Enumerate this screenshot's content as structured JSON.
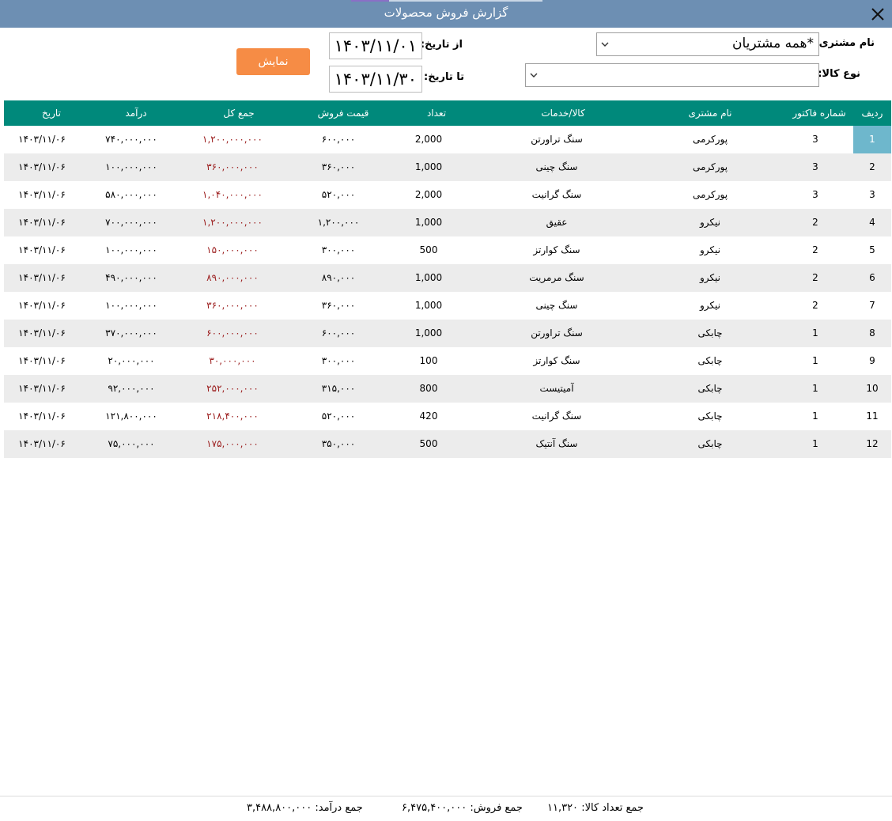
{
  "window": {
    "title": "گزارش فروش محصولات"
  },
  "filters": {
    "customer_label": "نام مشتری:",
    "customer_value": "*همه مشتریان",
    "product_label": "نوع کالا:",
    "product_value": "",
    "from_label": "از تاریخ:",
    "from_value": "۱۴۰۳/۱۱/۰۱",
    "to_label": "تا تاریخ:",
    "to_value": "۱۴۰۳/۱۱/۳۰",
    "show_button": "نمایش"
  },
  "table": {
    "columns": {
      "radif": "ردیف",
      "invoice": "شماره فاکتور",
      "customer": "نام مشتری",
      "product": "کالا/خدمات",
      "qty": "تعداد",
      "price": "قیمت فروش",
      "total": "جمع کل",
      "income": "درآمد",
      "date": "تاریخ"
    },
    "rows": [
      {
        "radif": "1",
        "invoice": "3",
        "customer": "پورکرمی",
        "product": "سنگ تراورتن",
        "qty": "2,000",
        "price": "۶۰۰,۰۰۰",
        "total": "۱,۲۰۰,۰۰۰,۰۰۰",
        "income": "۷۴۰,۰۰۰,۰۰۰",
        "date": "۱۴۰۳/۱۱/۰۶"
      },
      {
        "radif": "2",
        "invoice": "3",
        "customer": "پورکرمی",
        "product": "سنگ چینی",
        "qty": "1,000",
        "price": "۳۶۰,۰۰۰",
        "total": "۳۶۰,۰۰۰,۰۰۰",
        "income": "۱۰۰,۰۰۰,۰۰۰",
        "date": "۱۴۰۳/۱۱/۰۶"
      },
      {
        "radif": "3",
        "invoice": "3",
        "customer": "پورکرمی",
        "product": "سنگ گرانیت",
        "qty": "2,000",
        "price": "۵۲۰,۰۰۰",
        "total": "۱,۰۴۰,۰۰۰,۰۰۰",
        "income": "۵۸۰,۰۰۰,۰۰۰",
        "date": "۱۴۰۳/۱۱/۰۶"
      },
      {
        "radif": "4",
        "invoice": "2",
        "customer": "نیکرو",
        "product": "عقیق",
        "qty": "1,000",
        "price": "۱,۲۰۰,۰۰۰",
        "total": "۱,۲۰۰,۰۰۰,۰۰۰",
        "income": "۷۰۰,۰۰۰,۰۰۰",
        "date": "۱۴۰۳/۱۱/۰۶"
      },
      {
        "radif": "5",
        "invoice": "2",
        "customer": "نیکرو",
        "product": "سنگ کوارتز",
        "qty": "500",
        "price": "۳۰۰,۰۰۰",
        "total": "۱۵۰,۰۰۰,۰۰۰",
        "income": "۱۰۰,۰۰۰,۰۰۰",
        "date": "۱۴۰۳/۱۱/۰۶"
      },
      {
        "radif": "6",
        "invoice": "2",
        "customer": "نیکرو",
        "product": "سنگ مرمریت",
        "qty": "1,000",
        "price": "۸۹۰,۰۰۰",
        "total": "۸۹۰,۰۰۰,۰۰۰",
        "income": "۴۹۰,۰۰۰,۰۰۰",
        "date": "۱۴۰۳/۱۱/۰۶"
      },
      {
        "radif": "7",
        "invoice": "2",
        "customer": "نیکرو",
        "product": "سنگ چینی",
        "qty": "1,000",
        "price": "۳۶۰,۰۰۰",
        "total": "۳۶۰,۰۰۰,۰۰۰",
        "income": "۱۰۰,۰۰۰,۰۰۰",
        "date": "۱۴۰۳/۱۱/۰۶"
      },
      {
        "radif": "8",
        "invoice": "1",
        "customer": "چابکی",
        "product": "سنگ تراورتن",
        "qty": "1,000",
        "price": "۶۰۰,۰۰۰",
        "total": "۶۰۰,۰۰۰,۰۰۰",
        "income": "۳۷۰,۰۰۰,۰۰۰",
        "date": "۱۴۰۳/۱۱/۰۶"
      },
      {
        "radif": "9",
        "invoice": "1",
        "customer": "چابکی",
        "product": "سنگ کوارتز",
        "qty": "100",
        "price": "۳۰۰,۰۰۰",
        "total": "۳۰,۰۰۰,۰۰۰",
        "income": "۲۰,۰۰۰,۰۰۰",
        "date": "۱۴۰۳/۱۱/۰۶"
      },
      {
        "radif": "10",
        "invoice": "1",
        "customer": "چابکی",
        "product": "آمیتیست",
        "qty": "800",
        "price": "۳۱۵,۰۰۰",
        "total": "۲۵۲,۰۰۰,۰۰۰",
        "income": "۹۲,۰۰۰,۰۰۰",
        "date": "۱۴۰۳/۱۱/۰۶"
      },
      {
        "radif": "11",
        "invoice": "1",
        "customer": "چابکی",
        "product": "سنگ گرانیت",
        "qty": "420",
        "price": "۵۲۰,۰۰۰",
        "total": "۲۱۸,۴۰۰,۰۰۰",
        "income": "۱۲۱,۸۰۰,۰۰۰",
        "date": "۱۴۰۳/۱۱/۰۶"
      },
      {
        "radif": "12",
        "invoice": "1",
        "customer": "چابکی",
        "product": "سنگ آنتیک",
        "qty": "500",
        "price": "۳۵۰,۰۰۰",
        "total": "۱۷۵,۰۰۰,۰۰۰",
        "income": "۷۵,۰۰۰,۰۰۰",
        "date": "۱۴۰۳/۱۱/۰۶"
      }
    ]
  },
  "summary": {
    "qty_label": "جمع تعداد کالا:",
    "qty_value": "۱۱,۳۲۰",
    "sales_label": "جمع فروش:",
    "sales_value": "۶,۴۷۵,۴۰۰,۰۰۰",
    "income_label": "جمع درآمد:",
    "income_value": "۳,۴۸۸,۸۰۰,۰۰۰"
  },
  "icons": {
    "close": "close-icon",
    "dropdown": "chevron-down-icon"
  },
  "colors": {
    "titlebar": "#6d8fb3",
    "header": "#00897b",
    "button": "#f68c45",
    "total_text": "#9b1c1c",
    "selected": "#6eb7cc"
  }
}
